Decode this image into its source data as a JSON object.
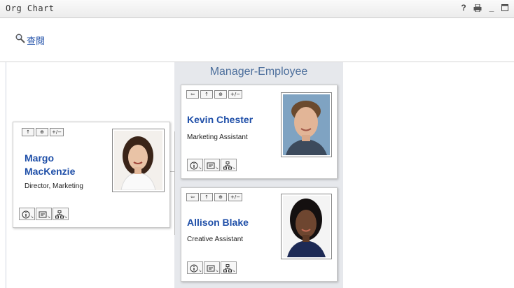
{
  "window": {
    "title": "Org Chart",
    "help_icon": "?",
    "print_icon": "printer-icon",
    "minimize_icon": "_",
    "maximize_icon": "maximize-icon"
  },
  "query": {
    "icon": "magnifier-icon",
    "label": "查閱"
  },
  "panel": {
    "title": "Manager-Employee"
  },
  "toolbar_labels": {
    "restore": "⇦",
    "up": "↑",
    "expand": "⊕",
    "plusminus": "+/−"
  },
  "manager": {
    "name_line1": "Margo",
    "name_line2": "MacKenzie",
    "title": "Director, Marketing"
  },
  "employees": [
    {
      "name": "Kevin Chester",
      "title": "Marketing Assistant"
    },
    {
      "name": "Allison Blake",
      "title": "Creative Assistant"
    }
  ],
  "action_icons": [
    "info-icon",
    "email-icon",
    "org-chart-icon"
  ],
  "colors": {
    "link": "#1f4fa8",
    "panel_bg": "#e6e8ec",
    "panel_title": "#4d6f9c"
  }
}
